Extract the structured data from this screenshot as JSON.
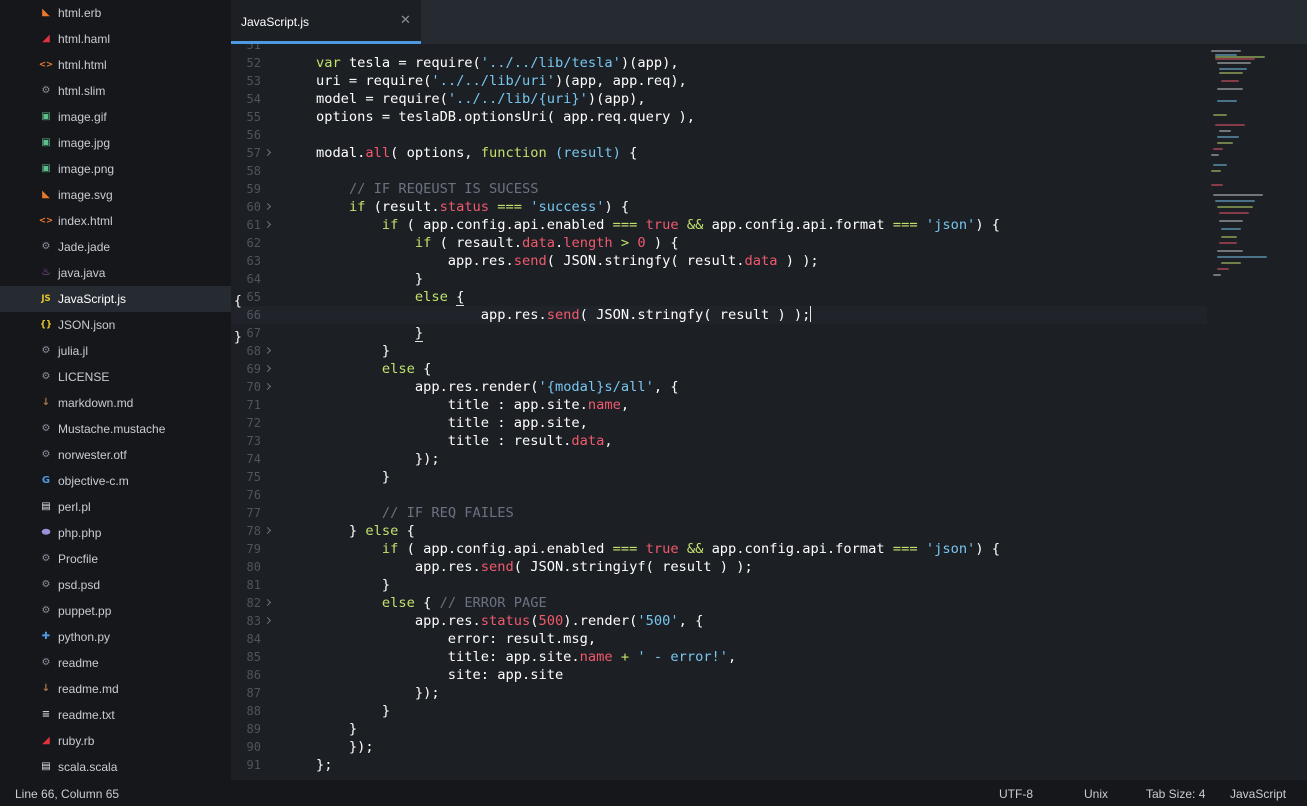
{
  "colors": {
    "accent": "#4d9ae0",
    "sidebar_bg": "#15171b",
    "editor_bg": "#1c1f24",
    "keyword": "#c2e26c",
    "string": "#78c7f0",
    "property": "#f05a6c",
    "function": "#c792ea",
    "comment": "#6b7280"
  },
  "sidebar": {
    "items": [
      {
        "label": "html.erb",
        "icon": "rss-icon",
        "glyph": "◣",
        "color": "#e8792b"
      },
      {
        "label": "html.haml",
        "icon": "haml-icon",
        "glyph": "◢",
        "color": "#e0313d"
      },
      {
        "label": "html.html",
        "icon": "code-brackets-icon",
        "glyph": "<>",
        "color": "#e8792b"
      },
      {
        "label": "html.slim",
        "icon": "gear-icon",
        "glyph": "⚙",
        "color": "#8a8f99"
      },
      {
        "label": "image.gif",
        "icon": "image-icon",
        "glyph": "▣",
        "color": "#5fbf8a"
      },
      {
        "label": "image.jpg",
        "icon": "image-icon",
        "glyph": "▣",
        "color": "#5fbf8a"
      },
      {
        "label": "image.png",
        "icon": "image-icon",
        "glyph": "▣",
        "color": "#5fbf8a"
      },
      {
        "label": "image.svg",
        "icon": "rss-icon",
        "glyph": "◣",
        "color": "#e8792b"
      },
      {
        "label": "index.html",
        "icon": "code-brackets-icon",
        "glyph": "<>",
        "color": "#e8792b"
      },
      {
        "label": "Jade.jade",
        "icon": "gear-icon",
        "glyph": "⚙",
        "color": "#8a8f99"
      },
      {
        "label": "java.java",
        "icon": "java-icon",
        "glyph": "♨",
        "color": "#b070d0"
      },
      {
        "label": "JavaScript.js",
        "icon": "js-icon",
        "glyph": "JS",
        "color": "#e8c92b"
      },
      {
        "label": "JSON.json",
        "icon": "braces-icon",
        "glyph": "{}",
        "color": "#e8c92b"
      },
      {
        "label": "julia.jl",
        "icon": "gear-icon",
        "glyph": "⚙",
        "color": "#8a8f99"
      },
      {
        "label": "LICENSE",
        "icon": "gear-icon",
        "glyph": "⚙",
        "color": "#8a8f99"
      },
      {
        "label": "markdown.md",
        "icon": "markdown-icon",
        "glyph": "↓",
        "color": "#b07a4a"
      },
      {
        "label": "Mustache.mustache",
        "icon": "gear-icon",
        "glyph": "⚙",
        "color": "#8a8f99"
      },
      {
        "label": "norwester.otf",
        "icon": "gear-icon",
        "glyph": "⚙",
        "color": "#8a8f99"
      },
      {
        "label": "objective-c.m",
        "icon": "objective-c-icon",
        "glyph": "G",
        "color": "#4d9ae0"
      },
      {
        "label": "perl.pl",
        "icon": "file-icon",
        "glyph": "▤",
        "color": "#e6e6e6"
      },
      {
        "label": "php.php",
        "icon": "php-icon",
        "glyph": "⬬",
        "color": "#9b8fd8"
      },
      {
        "label": "Procfile",
        "icon": "gear-icon",
        "glyph": "⚙",
        "color": "#8a8f99"
      },
      {
        "label": "psd.psd",
        "icon": "gear-icon",
        "glyph": "⚙",
        "color": "#8a8f99"
      },
      {
        "label": "puppet.pp",
        "icon": "gear-icon",
        "glyph": "⚙",
        "color": "#8a8f99"
      },
      {
        "label": "python.py",
        "icon": "python-icon",
        "glyph": "✚",
        "color": "#4d9ae0"
      },
      {
        "label": "readme",
        "icon": "gear-icon",
        "glyph": "⚙",
        "color": "#8a8f99"
      },
      {
        "label": "readme.md",
        "icon": "markdown-icon",
        "glyph": "↓",
        "color": "#b07a4a"
      },
      {
        "label": "readme.txt",
        "icon": "text-lines-icon",
        "glyph": "≡",
        "color": "#c9ccd1"
      },
      {
        "label": "ruby.rb",
        "icon": "ruby-icon",
        "glyph": "◢",
        "color": "#e0313d"
      },
      {
        "label": "scala.scala",
        "icon": "file-icon",
        "glyph": "▤",
        "color": "#e6e6e6"
      }
    ],
    "active_index": 11
  },
  "tab": {
    "label": "JavaScript.js",
    "close_glyph": "✕"
  },
  "editor": {
    "edge_brace_open": "{",
    "edge_brace_close": "}",
    "current_line": 66,
    "lines": [
      {
        "n": "51",
        "fold": false,
        "tokens": []
      },
      {
        "n": "52",
        "fold": false,
        "tokens": [
          [
            "    ",
            ""
          ],
          [
            "var",
            "kw"
          ],
          [
            " tesla = require(",
            ""
          ],
          [
            "'../../lib/tesla'",
            "str"
          ],
          [
            ")(app),",
            ""
          ]
        ]
      },
      {
        "n": "53",
        "fold": false,
        "tokens": [
          [
            "    uri = require(",
            ""
          ],
          [
            "'../../lib/uri'",
            "str"
          ],
          [
            ")(app, app.req),",
            ""
          ]
        ]
      },
      {
        "n": "54",
        "fold": false,
        "tokens": [
          [
            "    model = require(",
            ""
          ],
          [
            "'../../lib/{uri}'",
            "str"
          ],
          [
            ")(app),",
            ""
          ]
        ]
      },
      {
        "n": "55",
        "fold": false,
        "tokens": [
          [
            "    options = teslaDB.optionsUri( app.req.query ),",
            ""
          ]
        ]
      },
      {
        "n": "56",
        "fold": false,
        "tokens": []
      },
      {
        "n": "57",
        "fold": true,
        "tokens": [
          [
            "    modal.",
            ""
          ],
          [
            "all",
            "prop"
          ],
          [
            "( options, ",
            ""
          ],
          [
            "function",
            "kw"
          ],
          [
            " ",
            ""
          ],
          [
            "(result)",
            "str"
          ],
          [
            " {",
            ""
          ]
        ]
      },
      {
        "n": "58",
        "fold": false,
        "tokens": []
      },
      {
        "n": "59",
        "fold": false,
        "tokens": [
          [
            "        ",
            ""
          ],
          [
            "// IF REQEUST IS SUCESS",
            "cmt"
          ]
        ]
      },
      {
        "n": "60",
        "fold": true,
        "tokens": [
          [
            "        ",
            ""
          ],
          [
            "if",
            "kw"
          ],
          [
            " (result.",
            ""
          ],
          [
            "status",
            "prop"
          ],
          [
            " ",
            ""
          ],
          [
            "===",
            "op"
          ],
          [
            " ",
            ""
          ],
          [
            "'success'",
            "str"
          ],
          [
            ") {",
            ""
          ]
        ]
      },
      {
        "n": "61",
        "fold": true,
        "tokens": [
          [
            "            ",
            ""
          ],
          [
            "if",
            "kw"
          ],
          [
            " ( app.config.api.enabled ",
            ""
          ],
          [
            "===",
            "op"
          ],
          [
            " ",
            ""
          ],
          [
            "true",
            "tru"
          ],
          [
            " ",
            ""
          ],
          [
            "&&",
            "op"
          ],
          [
            " app.config.api.format ",
            ""
          ],
          [
            "===",
            "op"
          ],
          [
            " ",
            ""
          ],
          [
            "'json'",
            "str"
          ],
          [
            ") {",
            ""
          ]
        ]
      },
      {
        "n": "62",
        "fold": false,
        "tokens": [
          [
            "                ",
            ""
          ],
          [
            "if",
            "kw"
          ],
          [
            " ( resault.",
            ""
          ],
          [
            "data",
            "prop"
          ],
          [
            ".",
            ""
          ],
          [
            "length",
            "prop"
          ],
          [
            " ",
            ""
          ],
          [
            ">",
            "op"
          ],
          [
            " ",
            ""
          ],
          [
            "0",
            "num"
          ],
          [
            " ) {",
            ""
          ]
        ]
      },
      {
        "n": "63",
        "fold": false,
        "tokens": [
          [
            "                    app.res.",
            ""
          ],
          [
            "send",
            "prop"
          ],
          [
            "( JSON.stringfy( result.",
            ""
          ],
          [
            "data",
            "prop"
          ],
          [
            " ) );",
            ""
          ]
        ]
      },
      {
        "n": "64",
        "fold": false,
        "tokens": [
          [
            "                }",
            ""
          ]
        ]
      },
      {
        "n": "65",
        "fold": false,
        "tokens": [
          [
            "                ",
            ""
          ],
          [
            "else",
            "kw"
          ],
          [
            " ",
            ""
          ],
          [
            "{",
            "ubrace"
          ]
        ]
      },
      {
        "n": "66",
        "fold": false,
        "tokens": [
          [
            "                        app.res.",
            ""
          ],
          [
            "send",
            "prop"
          ],
          [
            "( JSON.stringfy( result ) );",
            ""
          ],
          [
            "",
            "caret"
          ]
        ]
      },
      {
        "n": "67",
        "fold": false,
        "tokens": [
          [
            "                ",
            ""
          ],
          [
            "}",
            "ubrace"
          ]
        ]
      },
      {
        "n": "68",
        "fold": true,
        "tokens": [
          [
            "            }",
            ""
          ]
        ]
      },
      {
        "n": "69",
        "fold": true,
        "tokens": [
          [
            "            ",
            ""
          ],
          [
            "else",
            "kw"
          ],
          [
            " {",
            ""
          ]
        ]
      },
      {
        "n": "70",
        "fold": true,
        "tokens": [
          [
            "                app.res.render(",
            ""
          ],
          [
            "'{modal}s/all'",
            "str"
          ],
          [
            ", {",
            ""
          ]
        ]
      },
      {
        "n": "71",
        "fold": false,
        "tokens": [
          [
            "                    title : app.site.",
            ""
          ],
          [
            "name",
            "prop"
          ],
          [
            ",",
            ""
          ]
        ]
      },
      {
        "n": "72",
        "fold": false,
        "tokens": [
          [
            "                    title : app.site,",
            ""
          ]
        ]
      },
      {
        "n": "73",
        "fold": false,
        "tokens": [
          [
            "                    title : result.",
            ""
          ],
          [
            "data",
            "prop"
          ],
          [
            ",",
            ""
          ]
        ]
      },
      {
        "n": "74",
        "fold": false,
        "tokens": [
          [
            "                });",
            ""
          ]
        ]
      },
      {
        "n": "75",
        "fold": false,
        "tokens": [
          [
            "            }",
            ""
          ]
        ]
      },
      {
        "n": "76",
        "fold": false,
        "tokens": []
      },
      {
        "n": "77",
        "fold": false,
        "tokens": [
          [
            "            ",
            ""
          ],
          [
            "// IF REQ FAILES",
            "cmt"
          ]
        ]
      },
      {
        "n": "78",
        "fold": true,
        "tokens": [
          [
            "        } ",
            ""
          ],
          [
            "else",
            "kw"
          ],
          [
            " {",
            ""
          ]
        ]
      },
      {
        "n": "79",
        "fold": false,
        "tokens": [
          [
            "            ",
            ""
          ],
          [
            "if",
            "kw"
          ],
          [
            " ( app.config.api.enabled ",
            ""
          ],
          [
            "===",
            "op"
          ],
          [
            " ",
            ""
          ],
          [
            "true",
            "tru"
          ],
          [
            " ",
            ""
          ],
          [
            "&&",
            "op"
          ],
          [
            " app.config.api.format ",
            ""
          ],
          [
            "===",
            "op"
          ],
          [
            " ",
            ""
          ],
          [
            "'json'",
            "str"
          ],
          [
            ") {",
            ""
          ]
        ]
      },
      {
        "n": "80",
        "fold": false,
        "tokens": [
          [
            "                app.res.",
            ""
          ],
          [
            "send",
            "prop"
          ],
          [
            "( JSON.stringiyf( result ) );",
            ""
          ]
        ]
      },
      {
        "n": "81",
        "fold": false,
        "tokens": [
          [
            "            }",
            ""
          ]
        ]
      },
      {
        "n": "82",
        "fold": true,
        "tokens": [
          [
            "            ",
            ""
          ],
          [
            "else",
            "kw"
          ],
          [
            " { ",
            ""
          ],
          [
            "// ERROR PAGE",
            "cmt"
          ]
        ]
      },
      {
        "n": "83",
        "fold": true,
        "tokens": [
          [
            "                app.res.",
            ""
          ],
          [
            "status",
            "prop"
          ],
          [
            "(",
            ""
          ],
          [
            "500",
            "num"
          ],
          [
            ").render(",
            ""
          ],
          [
            "'500'",
            "str"
          ],
          [
            ", {",
            ""
          ]
        ]
      },
      {
        "n": "84",
        "fold": false,
        "tokens": [
          [
            "                    error: result.msg,",
            ""
          ]
        ]
      },
      {
        "n": "85",
        "fold": false,
        "tokens": [
          [
            "                    title: app.site.",
            ""
          ],
          [
            "name",
            "prop"
          ],
          [
            " ",
            ""
          ],
          [
            "+",
            "op"
          ],
          [
            " ",
            ""
          ],
          [
            "' - error!'",
            "str"
          ],
          [
            ",",
            ""
          ]
        ]
      },
      {
        "n": "86",
        "fold": false,
        "tokens": [
          [
            "                    site: app.site",
            ""
          ]
        ]
      },
      {
        "n": "87",
        "fold": false,
        "tokens": [
          [
            "                });",
            ""
          ]
        ]
      },
      {
        "n": "88",
        "fold": false,
        "tokens": [
          [
            "            }",
            ""
          ]
        ]
      },
      {
        "n": "89",
        "fold": false,
        "tokens": [
          [
            "        }",
            ""
          ]
        ]
      },
      {
        "n": "90",
        "fold": false,
        "tokens": [
          [
            "        });",
            ""
          ]
        ]
      },
      {
        "n": "91",
        "fold": false,
        "tokens": [
          [
            "    };",
            ""
          ]
        ]
      }
    ]
  },
  "status": {
    "position": "Line 66, Column 65",
    "encoding": "UTF-8",
    "line_endings": "Unix",
    "tab_size": "Tab Size: 4",
    "syntax": "JavaScript"
  }
}
